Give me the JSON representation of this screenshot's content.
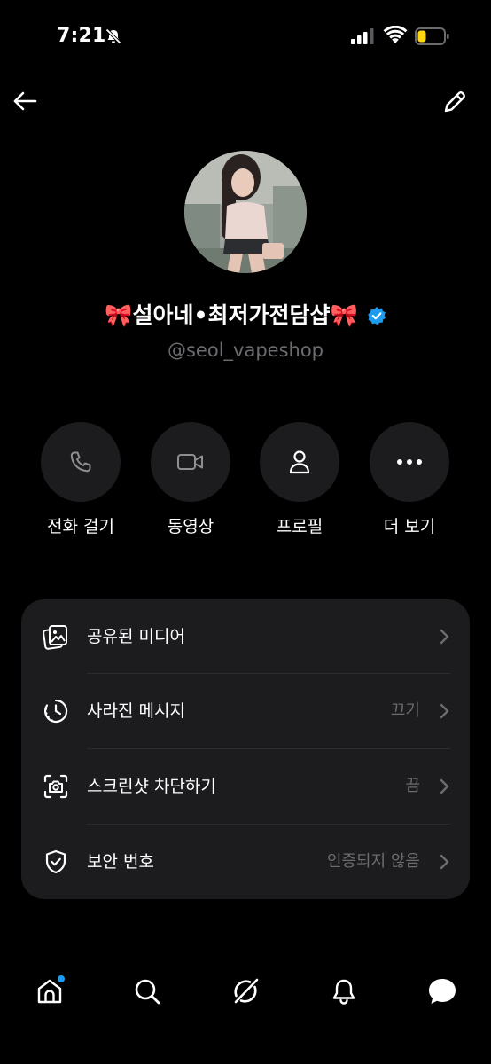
{
  "status_bar": {
    "time": "7:21",
    "icons": [
      "bell-slash-icon",
      "cellular-signal-icon",
      "wifi-icon",
      "battery-low-icon"
    ],
    "battery_color": "#ffd60a"
  },
  "header": {
    "back_icon": "arrow-left-icon",
    "edit_icon": "pencil-icon"
  },
  "profile": {
    "name": "🎀설아네•최저가전담샵🎀",
    "username": "@seol_vapeshop",
    "verified": true,
    "verified_color": "#1d9bf0"
  },
  "actions": [
    {
      "label": "전화 걸기",
      "icon": "phone-icon"
    },
    {
      "label": "동영상",
      "icon": "video-camera-icon"
    },
    {
      "label": "프로필",
      "icon": "person-icon"
    },
    {
      "label": "더 보기",
      "icon": "more-horizontal-icon"
    }
  ],
  "settings": [
    {
      "label": "공유된 미디어",
      "value": "",
      "icon": "media-gallery-icon"
    },
    {
      "label": "사라진 메시지",
      "value": "끄기",
      "icon": "timer-icon"
    },
    {
      "label": "스크린샷 차단하기",
      "value": "끔",
      "icon": "screenshot-camera-icon"
    },
    {
      "label": "보안 번호",
      "value": "인증되지 않음",
      "icon": "shield-check-icon"
    }
  ],
  "bottom_nav": {
    "items": [
      "home-icon",
      "search-icon",
      "grok-icon",
      "notifications-icon",
      "messages-icon"
    ],
    "home_badge_color": "#1d9bf0"
  }
}
